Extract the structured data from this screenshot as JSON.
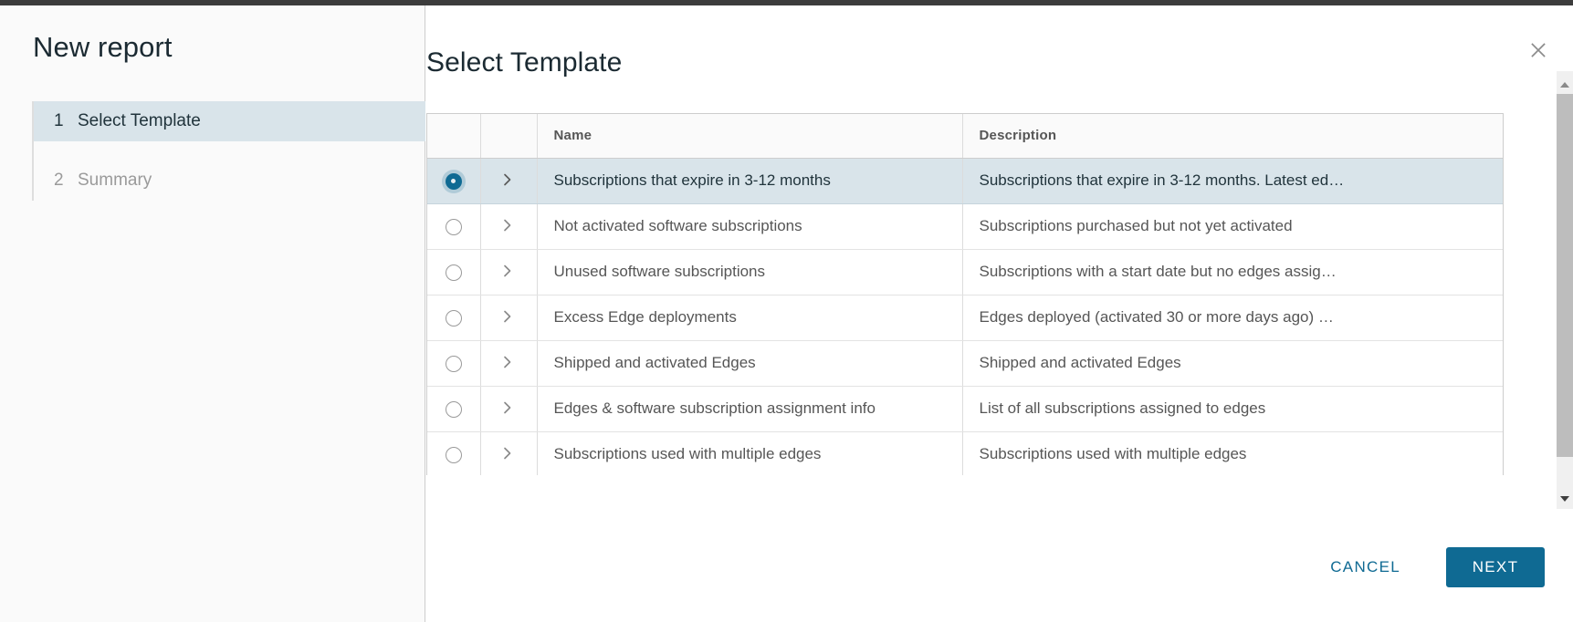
{
  "window": {
    "accent_color": "#0f6a93",
    "selected_row_bg": "#d9e4ea"
  },
  "sidebar": {
    "title": "New report",
    "steps": [
      {
        "num": "1",
        "label": "Select Template",
        "state": "active"
      },
      {
        "num": "2",
        "label": "Summary",
        "state": "inactive"
      }
    ]
  },
  "main": {
    "page_title": "Select Template",
    "close_icon": "close-icon"
  },
  "table": {
    "columns": [
      "",
      "",
      "Name",
      "Description"
    ],
    "headers": {
      "name": "Name",
      "description": "Description"
    },
    "rows": [
      {
        "selected": true,
        "name": "Subscriptions that expire in 3-12 months",
        "description": "Subscriptions that expire in 3-12 months. Latest ed…"
      },
      {
        "selected": false,
        "name": "Not activated software subscriptions",
        "description": "Subscriptions purchased but not yet activated"
      },
      {
        "selected": false,
        "name": "Unused software subscriptions",
        "description": "Subscriptions with a start date but no edges assig…"
      },
      {
        "selected": false,
        "name": "Excess Edge deployments",
        "description": "Edges deployed (activated 30 or more days ago) …"
      },
      {
        "selected": false,
        "name": "Shipped and activated Edges",
        "description": "Shipped and activated Edges"
      },
      {
        "selected": false,
        "name": "Edges & software subscription assignment info",
        "description": "List of all subscriptions assigned to edges"
      },
      {
        "selected": false,
        "name": "Subscriptions used with multiple edges",
        "description": "Subscriptions used with multiple edges"
      }
    ]
  },
  "footer": {
    "cancel_label": "CANCEL",
    "next_label": "NEXT"
  },
  "scrollbar": {
    "up_icon": "scroll-up-arrow-icon",
    "down_icon": "scroll-down-arrow-icon"
  }
}
